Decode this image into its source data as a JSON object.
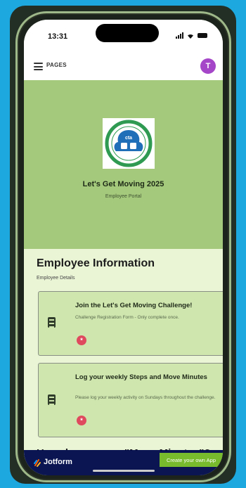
{
  "status_bar": {
    "time": "13:31"
  },
  "topnav": {
    "pages_label": "PAGES",
    "avatar_initial": "T"
  },
  "hero": {
    "logo": {
      "top_text": "HUMAN RESOURCES",
      "center_text": "cta",
      "bottom_text": "WELLNESS"
    },
    "title": "Let's Get Moving 2025",
    "subtitle": "Employee Portal"
  },
  "section": {
    "title": "Employee Information",
    "subtitle": "Employee Details"
  },
  "cards": [
    {
      "title": "Join the Let's Get Moving Challenge!",
      "description": "Challenge Registration Form - Only complete once.",
      "required_marker": "*"
    },
    {
      "title": "Log your weekly Steps and Move Minutes",
      "description": "Please log your weekly activity on Sundays throughout the challenge.",
      "required_marker": "*"
    }
  ],
  "next_section": {
    "title": "How do you earn \"Move Minutes\"?"
  },
  "bottom_bar": {
    "brand": "Jotform",
    "cta_label": "Create your own App"
  },
  "colors": {
    "page_bg": "#1ea8e0",
    "hero_bg": "#a4c97c",
    "content_bg": "#eaf5d6",
    "card_bg": "#cfe6ae",
    "avatar": "#a545c8",
    "required": "#e04a5e",
    "bottom_bar": "#0a1551",
    "cta": "#78bb2c"
  }
}
